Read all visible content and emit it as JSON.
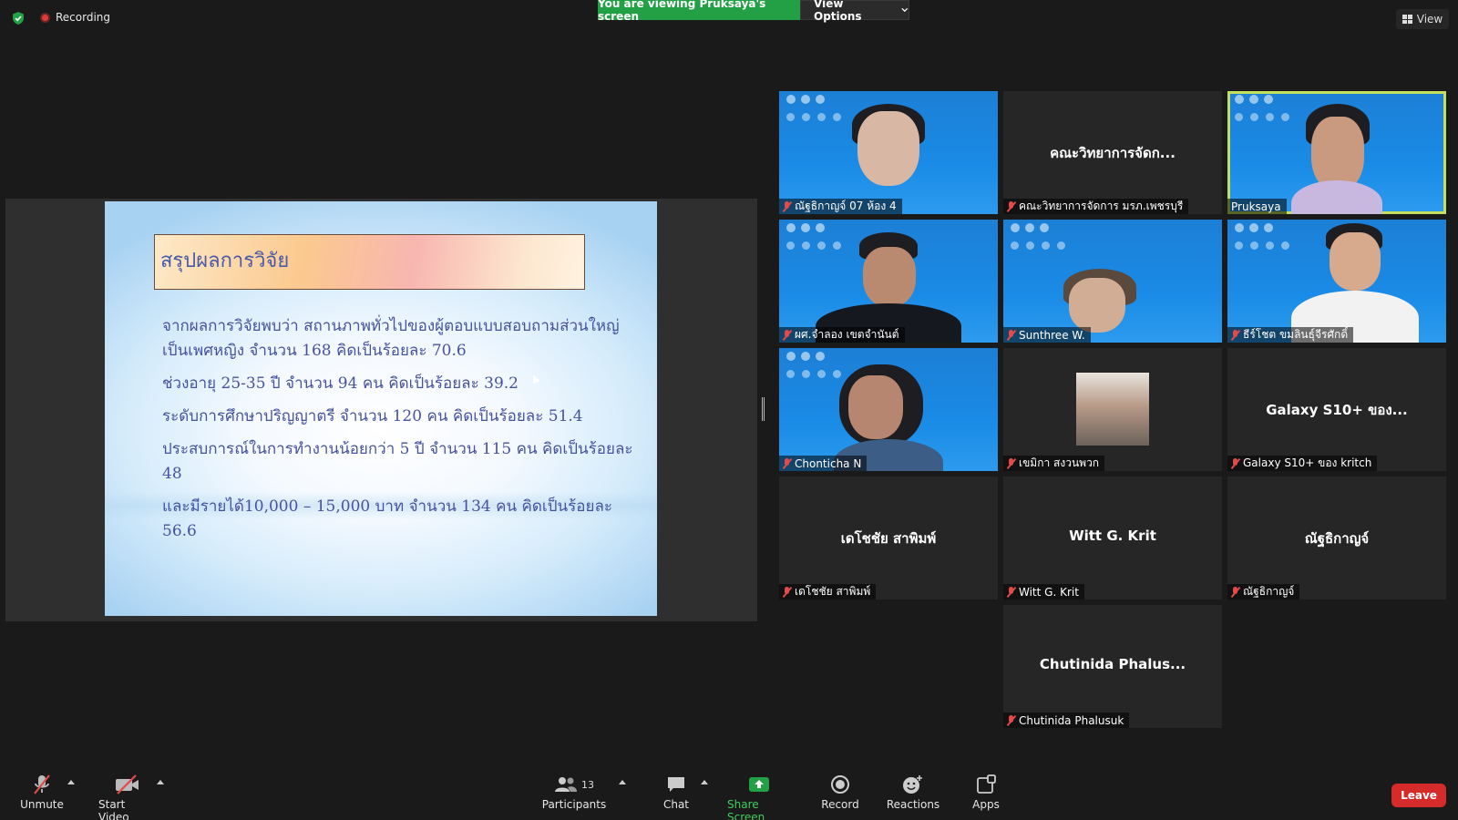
{
  "topbar": {
    "recording_label": "Recording",
    "viewing_banner": "You are viewing Pruksaya's screen",
    "view_options_label": "View Options",
    "view_label": "View"
  },
  "slide": {
    "title": "สรุปผลการวิจัย",
    "paragraphs": [
      "จากผลการวิจัยพบว่า  สถานภาพทั่วไปของผู้ตอบแบบสอบถามส่วนใหญ่เป็นเพศหญิง จำนวน 168 คิดเป็นร้อยละ 70.6",
      "ช่วงอายุ 25-35 ปี จำนวน 94 คน คิดเป็นร้อยละ 39.2",
      "ระดับการศึกษาปริญญาตรี จำนวน 120 คน คิดเป็นร้อยละ 51.4",
      "ประสบการณ์ในการทำงานน้อยกว่า 5 ปี จำนวน 115 คน คิดเป็นร้อยละ 48",
      "และมีรายได้10,000 – 15,000 บาท จำนวน 134 คน คิดเป็นร้อยละ 56.6"
    ]
  },
  "participants": [
    {
      "label": "ณัฐธิกาญจ์ 07 ห้อง 4",
      "type": "video"
    },
    {
      "label": "คณะวิทยาการจัดการ มรภ.เพชรบุรี",
      "center": "คณะวิทยาการจัดก...",
      "type": "name"
    },
    {
      "label": "Pruksaya",
      "type": "video"
    },
    {
      "label": "ผศ.จำลอง เขตจำนันต์",
      "type": "video"
    },
    {
      "label": "Sunthree W.",
      "type": "video"
    },
    {
      "label": "ธีร์โชต ขมลินธุ์จีรศักดิ์",
      "type": "video"
    },
    {
      "label": "Chonticha N",
      "type": "video"
    },
    {
      "label": "เขมิกา สงวนพวก",
      "type": "photo"
    },
    {
      "label": "Galaxy S10+ ของ kritch",
      "center": "Galaxy S10+ ของ...",
      "type": "name"
    },
    {
      "label": "เดโชชัย สาพิมพ์",
      "center": "เดโชชัย สาพิมพ์",
      "type": "name"
    },
    {
      "label": "Witt G. Krit",
      "center": "Witt G. Krit",
      "type": "name"
    },
    {
      "label": "ณัฐธิกาญจ์",
      "center": "ณัฐธิกาญจ์",
      "type": "name"
    },
    {
      "label": "Chutinida Phalusuk",
      "center": "Chutinida  Phalus...",
      "type": "name"
    }
  ],
  "toolbar": {
    "unmute": "Unmute",
    "start_video": "Start Video",
    "participants": "Participants",
    "participant_count": "13",
    "chat": "Chat",
    "share_screen": "Share Screen",
    "record": "Record",
    "reactions": "Reactions",
    "apps": "Apps",
    "leave": "Leave"
  },
  "colors": {
    "share_green": "#23a045",
    "leave_red": "#d52b2b",
    "active_speaker": "#c4e05a",
    "slide_text": "#45539e"
  }
}
